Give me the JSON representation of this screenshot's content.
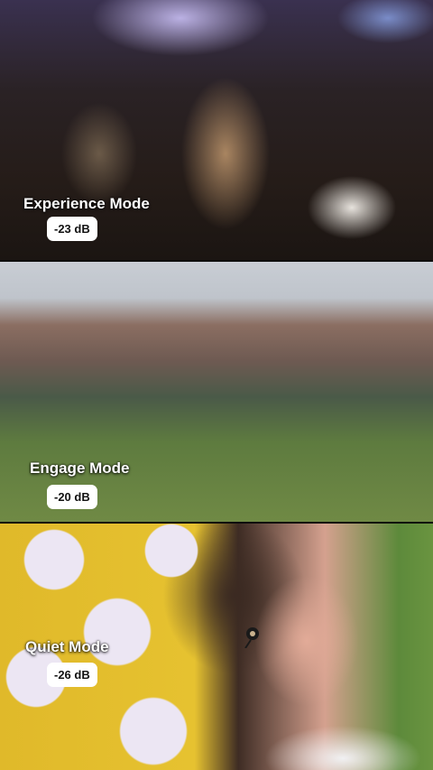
{
  "panels": [
    {
      "mode": "Experience Mode",
      "db": "-23 dB"
    },
    {
      "mode": "Engage Mode",
      "db": "-20 dB"
    },
    {
      "mode": "Quiet Mode",
      "db": "-26 dB"
    }
  ],
  "colors": {
    "label_text": "#ffffff",
    "badge_bg": "#ffffff",
    "badge_text": "#111111"
  }
}
